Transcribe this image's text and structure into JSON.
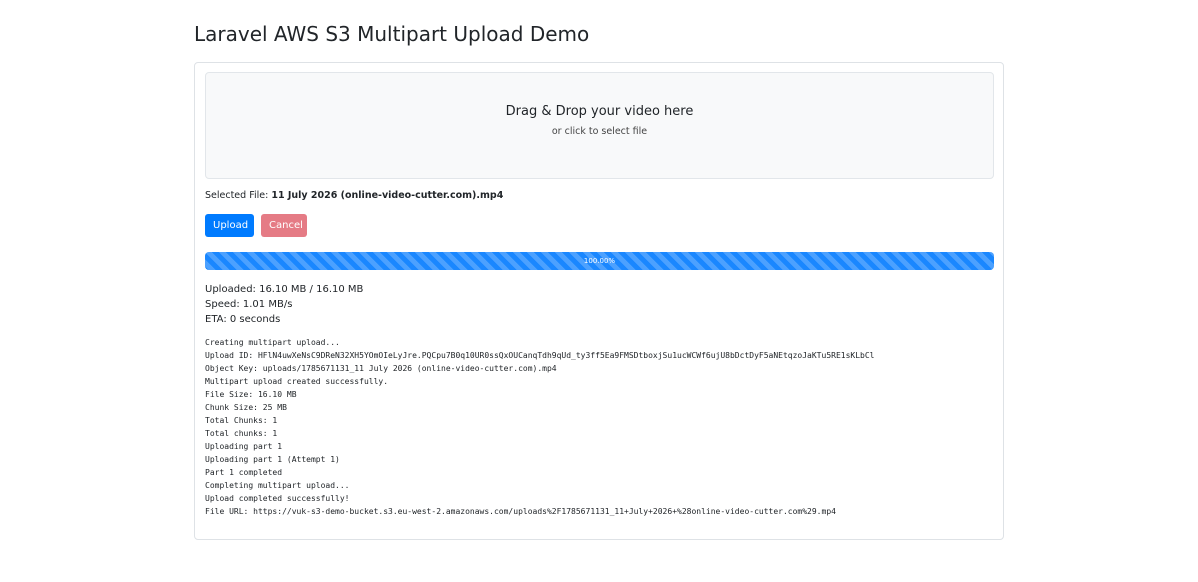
{
  "page": {
    "title": "Laravel AWS S3 Multipart Upload Demo"
  },
  "dropzone": {
    "title": "Drag & Drop your video here",
    "subtitle": "or click to select file"
  },
  "selected_file": {
    "label": "Selected File:",
    "name": "11 July 2026 (online-video-cutter.com).mp4"
  },
  "buttons": {
    "upload": "Upload",
    "cancel": "Cancel"
  },
  "progress": {
    "percent": 100,
    "label": "100.00%"
  },
  "stats": {
    "uploaded": "Uploaded: 16.10 MB / 16.10 MB",
    "speed": "Speed: 1.01 MB/s",
    "eta": "ETA: 0 seconds"
  },
  "log": [
    "Creating multipart upload...",
    "Upload ID: HFlN4uwXeNsC9DReN32XH5YOmOIeLyJre.PQCpu7B0q10UR0ssQxOUCanqTdh9qUd_ty3ff5Ea9FMSDtboxjSu1ucWCWf6ujU8bDctDyF5aNEtqzoJaKTu5RE1sKLbCl",
    "Object Key: uploads/1785671131_11 July 2026 (online-video-cutter.com).mp4",
    "Multipart upload created successfully.",
    "File Size: 16.10 MB",
    "Chunk Size: 25 MB",
    "Total Chunks: 1",
    "Total chunks: 1",
    "Uploading part 1",
    "Uploading part 1 (Attempt 1)",
    "Part 1 completed",
    "Completing multipart upload...",
    "Upload completed successfully!",
    "File URL: https://vuk-s3-demo-bucket.s3.eu-west-2.amazonaws.com/uploads%2F1785671131_11+July+2026+%28online-video-cutter.com%29.mp4"
  ],
  "colors": {
    "primary": "#007bff",
    "cancel": "#e57b85",
    "progress": "#1a87ff"
  }
}
